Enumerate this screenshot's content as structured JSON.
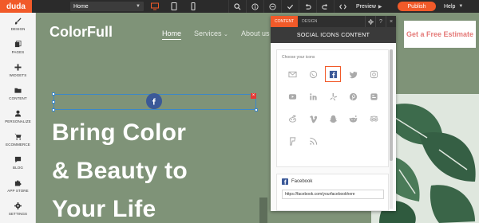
{
  "app": {
    "logo": "duda"
  },
  "topbar": {
    "page_select": "Home",
    "preview_label": "Preview",
    "publish_label": "Publish",
    "help_label": "Help"
  },
  "sidebar": {
    "items": [
      {
        "label": "DESIGN",
        "icon": "brush-icon"
      },
      {
        "label": "PAGES",
        "icon": "pages-icon"
      },
      {
        "label": "WIDGETS",
        "icon": "plus-icon"
      },
      {
        "label": "CONTENT",
        "icon": "folder-icon"
      },
      {
        "label": "PERSONALIZE",
        "icon": "person-icon"
      },
      {
        "label": "ECOMMERCE",
        "icon": "cart-icon"
      },
      {
        "label": "BLOG",
        "icon": "chat-icon"
      },
      {
        "label": "APP STORE",
        "icon": "puzzle-icon"
      },
      {
        "label": "SETTINGS",
        "icon": "gear-icon"
      }
    ]
  },
  "site": {
    "brand": "ColorFull",
    "nav": {
      "home": "Home",
      "services": "Services",
      "about": "About us"
    },
    "cta": "Get a Free Estimate",
    "hero": [
      "Bring Color",
      "& Beauty to",
      "Your Life"
    ]
  },
  "panel": {
    "tabs": {
      "content": "CONTENT",
      "design": "DESIGN"
    },
    "title": "SOCIAL ICONS CONTENT",
    "choose_label": "Choose your icons",
    "icons": [
      "email-icon",
      "whatsapp-icon",
      "facebook-icon",
      "twitter-icon",
      "instagram-icon",
      "youtube-icon",
      "linkedin-icon",
      "yelp-icon",
      "pinterest-icon",
      "blogger-icon",
      "reddit-icon",
      "vimeo-icon",
      "snapchat-icon",
      "reddit-alien-icon",
      "tripadvisor-icon",
      "foursquare-icon",
      "rss-icon"
    ],
    "selected_icon": "facebook-icon",
    "facebook": {
      "label": "Facebook",
      "url": "https://facebook.com/yourfacebookhere"
    }
  },
  "colors": {
    "accent": "#f15a29",
    "topbar": "#2b2b2b",
    "site_bg": "#7f9378",
    "facebook": "#3b5998",
    "cta_text": "#e57a78"
  }
}
